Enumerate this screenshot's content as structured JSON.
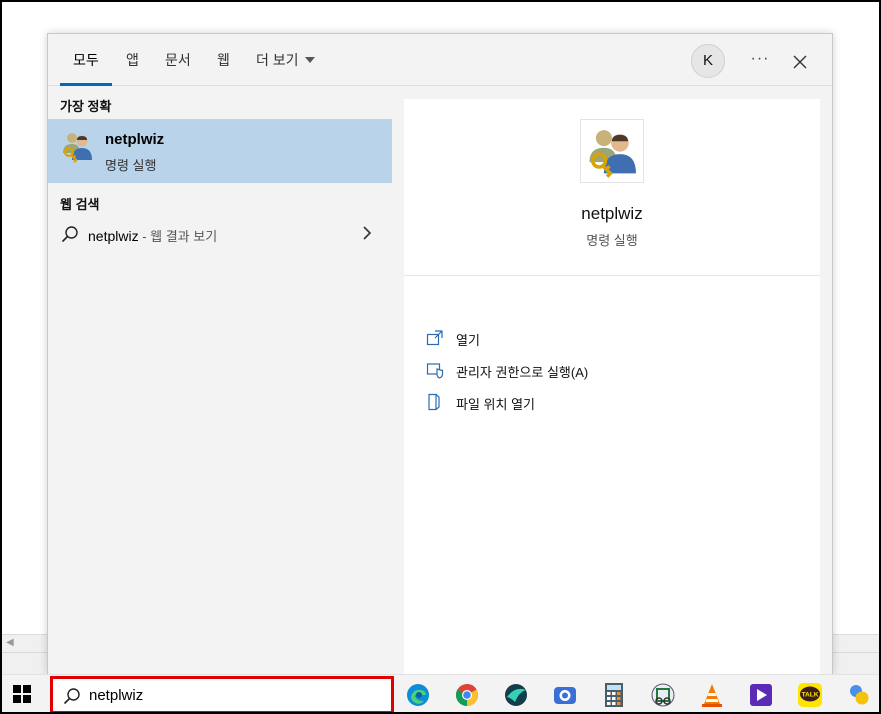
{
  "tabs": [
    {
      "label": "모두",
      "active": true
    },
    {
      "label": "앱",
      "active": false
    },
    {
      "label": "문서",
      "active": false
    },
    {
      "label": "웹",
      "active": false
    },
    {
      "label": "더 보기",
      "active": false,
      "dropdown": true
    }
  ],
  "header": {
    "avatar_initial": "K",
    "more_label": "···",
    "close_icon": "close-icon"
  },
  "left": {
    "best_match_title": "가장 정확",
    "best_match": {
      "name": "netplwiz",
      "subtitle": "명령 실행",
      "icon": "users-key-icon"
    },
    "web_search_title": "웹 검색",
    "web_item": {
      "query": "netplwiz",
      "hint": " - 웹 결과 보기",
      "icon": "search-icon",
      "chevron": "chevron-right-icon"
    }
  },
  "detail": {
    "title": "netplwiz",
    "subtitle": "명령 실행",
    "icon": "users-key-icon",
    "actions": [
      {
        "label": "열기",
        "icon": "open-icon"
      },
      {
        "label": "관리자 권한으로 실행(A)",
        "icon": "shield-icon"
      },
      {
        "label": "파일 위치 열기",
        "icon": "file-location-icon"
      }
    ]
  },
  "taskbar": {
    "search_value": "netplwiz",
    "search_icon": "search-icon",
    "apps": [
      "edge-icon",
      "chrome-icon",
      "swing-browser-icon",
      "camera-app-icon",
      "calculator-icon",
      "snipping-tool-icon",
      "vlc-icon",
      "media-player-icon",
      "kakaotalk-icon",
      "widgets-icon"
    ],
    "kakaotalk_label": "TALK",
    "highlight_color": "#e00000"
  },
  "colors": {
    "accent": "#0067c0",
    "selection": "#b9d3ea"
  }
}
